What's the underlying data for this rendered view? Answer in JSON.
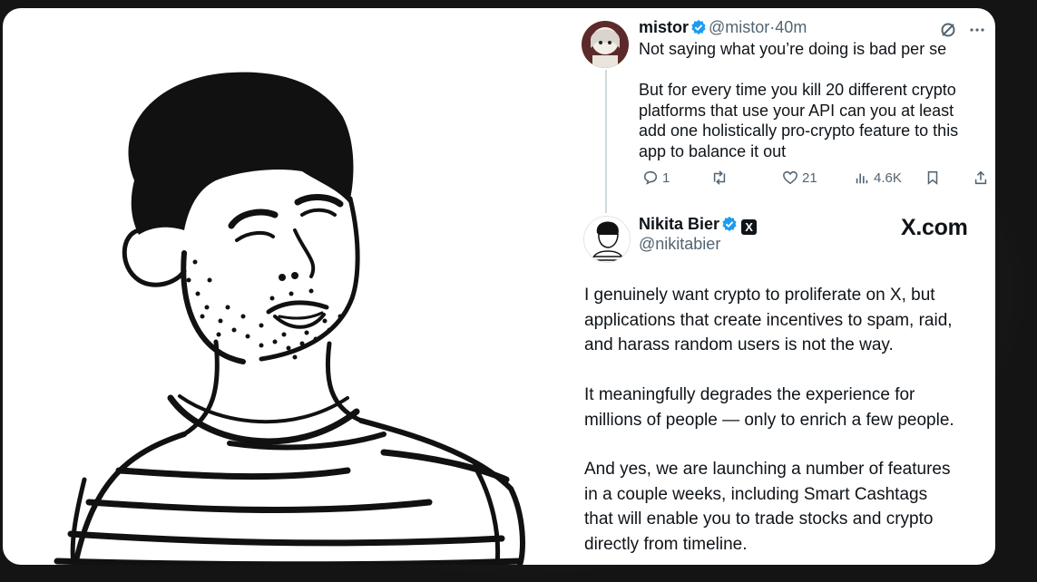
{
  "reply": {
    "name": "mistor",
    "handle": "@mistor",
    "separator": "·",
    "time": "40m",
    "text_line1": "Not saying what you’re doing is bad per se",
    "text_body": "But for every time you kill 20 different crypto\nplatforms that use your API can you at least\nadd one holistically pro-crypto feature to this\napp to balance it out",
    "metrics": {
      "replies": "1",
      "reposts": "",
      "likes": "21",
      "views": "4.6K"
    }
  },
  "main_post": {
    "name": "Nikita Bier",
    "handle": "@nikitabier",
    "badge": "X",
    "paragraph1": "I genuinely want crypto to proliferate on X, but\napplications that create incentives to spam, raid,\nand harass random users is not the way.",
    "paragraph2": "It meaningfully degrades the experience for\nmillions of people — only to enrich a few people.",
    "paragraph3": "And yes, we are launching a number of features\nin a couple weeks, including Smart Cashtags\nthat will enable you to trade stocks and crypto\ndirectly from timeline."
  },
  "watermark": "X.com",
  "colors": {
    "verified": "#1d9bf0",
    "text": "#0f1419",
    "secondary": "#536471",
    "card_bg": "#ffffff"
  },
  "icons": [
    "verified-badge-icon",
    "grok-icon",
    "more-icon",
    "reply-icon",
    "repost-icon",
    "like-icon",
    "views-icon",
    "bookmark-icon",
    "share-icon",
    "x-badge-icon"
  ]
}
